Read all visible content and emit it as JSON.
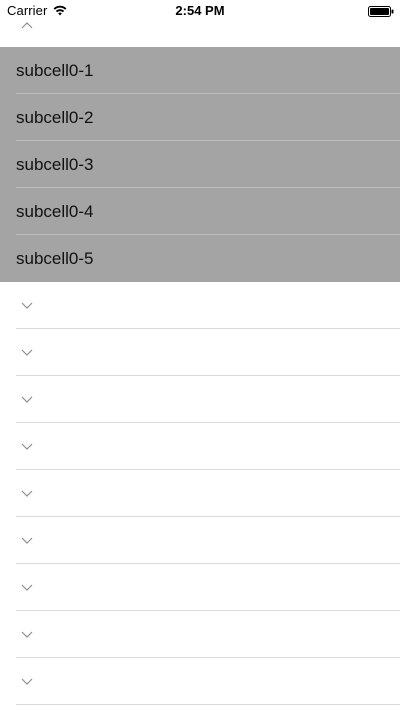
{
  "status_bar": {
    "carrier": "Carrier",
    "time": "2:54 PM",
    "wifi_icon": "wifi-icon",
    "battery_icon": "battery-icon"
  },
  "table": {
    "expanded_header_icon": "chevron-up-icon",
    "subcells": [
      {
        "label": "subcell0-1"
      },
      {
        "label": "subcell0-2"
      },
      {
        "label": "subcell0-3"
      },
      {
        "label": "subcell0-4"
      },
      {
        "label": "subcell0-5"
      }
    ],
    "collapsed_rows_icon": "chevron-down-icon",
    "collapsed_row_count": 9
  },
  "colors": {
    "subcell_background": "#a4a4a4",
    "separator": "#d9d9d9",
    "chevron": "#8e8e93"
  }
}
